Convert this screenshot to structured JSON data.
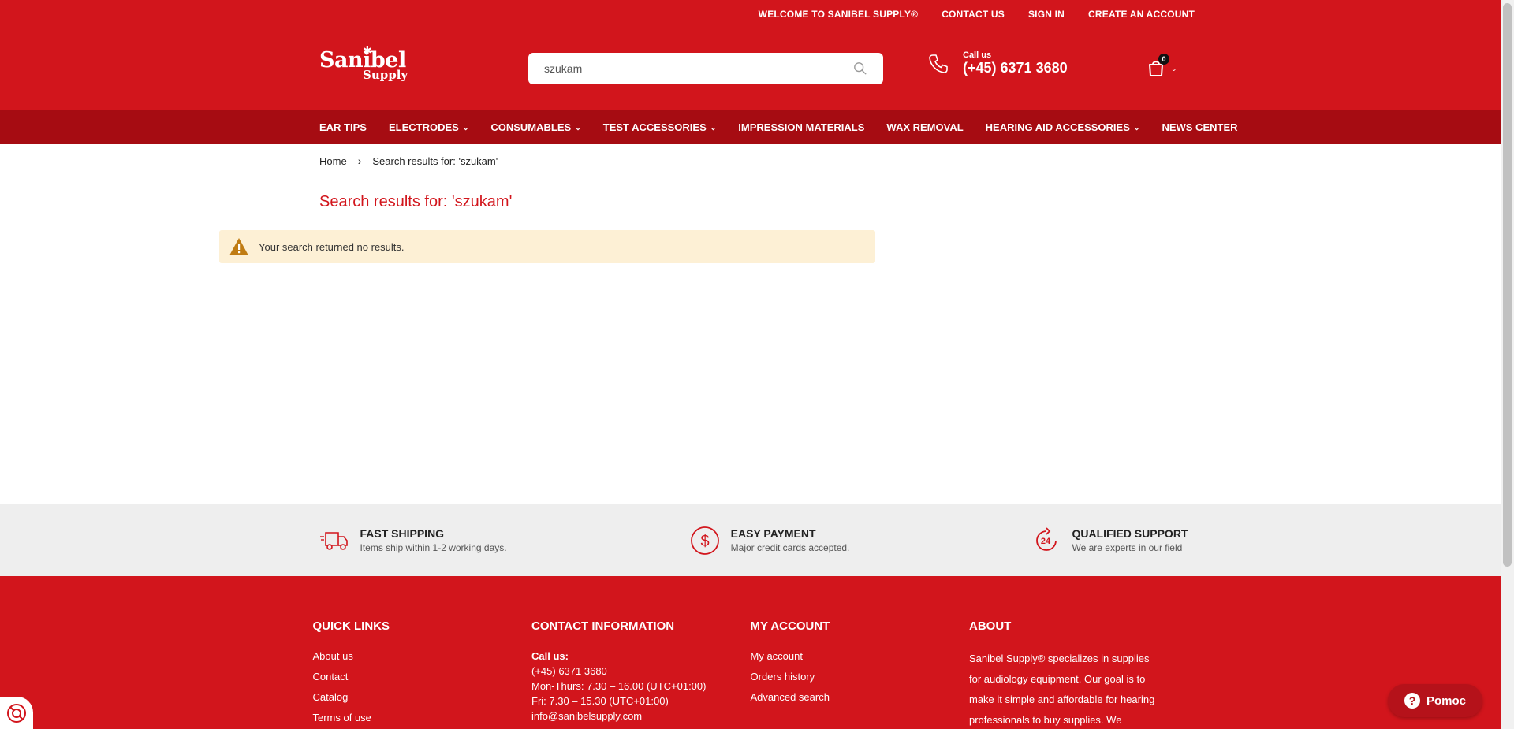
{
  "topbar": {
    "welcome": "WELCOME TO SANIBEL SUPPLY®",
    "contact": "CONTACT US",
    "sign_in": "SIGN IN",
    "create_account": "CREATE AN ACCOUNT"
  },
  "logo": {
    "line1": "Sanibel",
    "line2": "Supply"
  },
  "search": {
    "value": "szukam",
    "icon": "search-icon"
  },
  "phone": {
    "label": "Call us",
    "number": "(+45) 6371 3680",
    "icon": "phone-icon"
  },
  "cart": {
    "count": "0",
    "icon": "cart-icon"
  },
  "nav": {
    "items": [
      {
        "label": "EAR TIPS",
        "dropdown": false
      },
      {
        "label": "ELECTRODES",
        "dropdown": true
      },
      {
        "label": "CONSUMABLES",
        "dropdown": true
      },
      {
        "label": "TEST ACCESSORIES",
        "dropdown": true
      },
      {
        "label": "IMPRESSION MATERIALS",
        "dropdown": false
      },
      {
        "label": "WAX REMOVAL",
        "dropdown": false
      },
      {
        "label": "HEARING AID ACCESSORIES",
        "dropdown": true
      },
      {
        "label": "NEWS CENTER",
        "dropdown": false
      }
    ]
  },
  "breadcrumb": {
    "home": "Home",
    "current": "Search results for: 'szukam'"
  },
  "main": {
    "title": "Search results for: 'szukam'",
    "notice": "Your search returned no results."
  },
  "features": [
    {
      "title": "FAST SHIPPING",
      "desc": "Items ship within 1-2 working days.",
      "icon": "truck-icon"
    },
    {
      "title": "EASY PAYMENT",
      "desc": "Major credit cards accepted.",
      "icon": "dollar-icon"
    },
    {
      "title": "QUALIFIED SUPPORT",
      "desc": "We are experts in our field",
      "icon": "support-24-icon"
    }
  ],
  "footer": {
    "quick_links": {
      "heading": "QUICK LINKS",
      "links": [
        "About us",
        "Contact",
        "Catalog",
        "Terms of use"
      ]
    },
    "contact": {
      "heading": "CONTACT INFORMATION",
      "call_label": "Call us:",
      "phone": "(+45) 6371 3680",
      "hours1": "Mon-Thurs: 7.30 – 16.00 (UTC+01:00)",
      "hours2": "Fri: 7.30 – 15.30 (UTC+01:00)",
      "email": "info@sanibelsupply.com"
    },
    "account": {
      "heading": "MY ACCOUNT",
      "links": [
        "My account",
        "Orders history",
        "Advanced search"
      ]
    },
    "about": {
      "heading": "ABOUT",
      "lines": [
        "Sanibel Supply® specializes in supplies",
        "for audiology equipment. Our goal is to",
        "make it simple and affordable for hearing",
        "professionals to buy supplies. We"
      ]
    }
  },
  "help_button": {
    "label": "Pomoc"
  },
  "colors": {
    "brand_red": "#d2151c",
    "nav_red": "#a60c12",
    "notice_bg": "#fdf0d5"
  }
}
